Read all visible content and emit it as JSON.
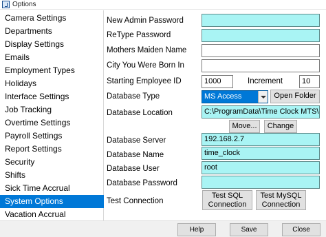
{
  "window": {
    "title": "Options"
  },
  "sidebar": {
    "items": [
      {
        "label": "Camera Settings"
      },
      {
        "label": "Departments"
      },
      {
        "label": "Display Settings"
      },
      {
        "label": "Emails"
      },
      {
        "label": "Employment Types"
      },
      {
        "label": "Holidays"
      },
      {
        "label": "Interface Settings"
      },
      {
        "label": "Job Tracking"
      },
      {
        "label": "Overtime Settings"
      },
      {
        "label": "Payroll Settings"
      },
      {
        "label": "Report Settings"
      },
      {
        "label": "Security"
      },
      {
        "label": "Shifts"
      },
      {
        "label": "Sick Time Accrual"
      },
      {
        "label": "System Options",
        "selected": true
      },
      {
        "label": "Vacation Accrual"
      }
    ]
  },
  "form": {
    "new_admin_password": {
      "label": "New Admin Password",
      "value": ""
    },
    "retype_password": {
      "label": "ReType Password",
      "value": ""
    },
    "mothers_maiden_name": {
      "label": "Mothers Maiden Name",
      "value": ""
    },
    "city_born_in": {
      "label": "City You Were Born In",
      "value": ""
    },
    "starting_employee_id": {
      "label": "Starting Employee ID",
      "value": "1000"
    },
    "increment": {
      "label": "Increment",
      "value": "10"
    },
    "database_type": {
      "label": "Database Type",
      "value": "MS Access"
    },
    "open_folder_label": "Open Folder",
    "database_location": {
      "label": "Database Location",
      "value": "C:\\ProgramData\\Time Clock MTS\\database\\"
    },
    "move_label": "Move...",
    "change_label": "Change",
    "database_server": {
      "label": "Database Server",
      "value": "192.168.2.7"
    },
    "database_name": {
      "label": "Database Name",
      "value": "time_clock"
    },
    "database_user": {
      "label": "Database User",
      "value": "root"
    },
    "database_password": {
      "label": "Database Password",
      "value": ""
    },
    "test_connection": {
      "label": "Test Connection"
    },
    "test_sql_line1": "Test SQL",
    "test_sql_line2": "Connection",
    "test_mysql_line1": "Test MySQL",
    "test_mysql_line2": "Connection"
  },
  "footer": {
    "help_label": "Help",
    "save_label": "Save",
    "close_label": "Close"
  },
  "colors": {
    "selected_bg": "#0078d7",
    "field_cyan": "#a9f4f4",
    "button_bg": "#e1e1e1"
  }
}
